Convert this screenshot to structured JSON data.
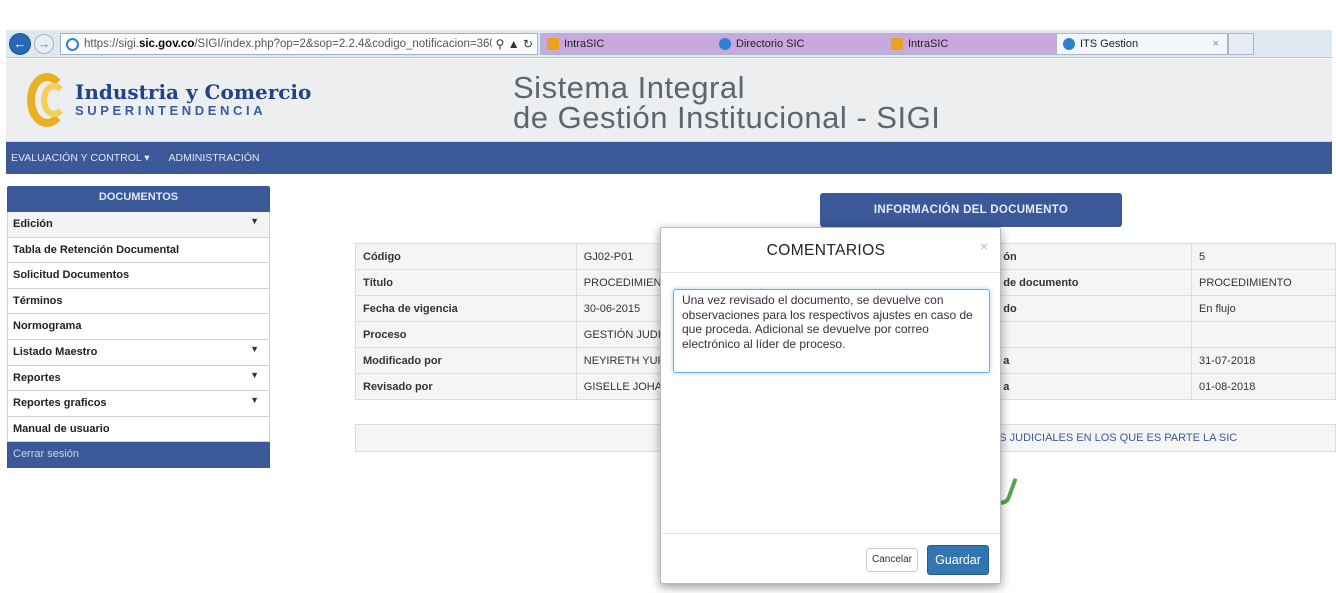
{
  "browser": {
    "url_prefix": "https://sigi.",
    "url_domain": "sic.gov.co",
    "url_rest": "/SIGI/index.php?op=2&sop=2.2.4&codigo_notificacion=3606",
    "tabs": [
      {
        "label": "IntraSIC",
        "style": "purple"
      },
      {
        "label": "Directorio SIC",
        "style": "purple"
      },
      {
        "label": "IntraSIC",
        "style": "purple"
      },
      {
        "label": "ITS Gestion",
        "style": "active"
      }
    ],
    "close_glyph": "×"
  },
  "header": {
    "logo_name": "Industria y Comercio",
    "logo_sub": "SUPERINTENDENCIA",
    "title_line1": "Sistema Integral",
    "title_line2": "de Gestión Institucional - SIGI"
  },
  "nav": {
    "items": [
      "EVALUACIÓN Y CONTROL ▾",
      "ADMINISTRACIÓN"
    ]
  },
  "sidebar": {
    "heading": "DOCUMENTOS",
    "items": [
      {
        "label": "Edición",
        "has_caret": true
      },
      {
        "label": "Tabla de Retención Documental",
        "has_caret": false
      },
      {
        "label": "Solicitud Documentos",
        "has_caret": false
      },
      {
        "label": "Términos",
        "has_caret": false
      },
      {
        "label": "Normograma",
        "has_caret": false
      },
      {
        "label": "Listado Maestro",
        "has_caret": true
      },
      {
        "label": "Reportes",
        "has_caret": true
      },
      {
        "label": "Reportes graficos",
        "has_caret": true
      },
      {
        "label": "Manual de usuario",
        "has_caret": false
      }
    ],
    "logout": "Cerrar sesión"
  },
  "info": {
    "button": "INFORMACIÓN DEL DOCUMENTO",
    "rows": [
      {
        "l1": "Código",
        "v1": "GJ02-P01",
        "l2": "ón",
        "v2": "5"
      },
      {
        "l1": "Título",
        "v1": "PROCEDIMIENT",
        "l2": "de documento",
        "v2": "PROCEDIMIENTO"
      },
      {
        "l1": "Fecha de vigencia",
        "v1": "30-06-2015",
        "l2": "do",
        "v2": "En flujo"
      },
      {
        "l1": "Proceso",
        "v1": "GESTIÓN JUDIC",
        "l2": "",
        "v2": ""
      },
      {
        "l1": "Modificado por",
        "v1": "NEYIRETH YUR",
        "l2": "a",
        "v2": "31-07-2018"
      },
      {
        "l1": "Revisado por",
        "v1": "GISELLE JOHA",
        "l2": "a",
        "v2": "01-08-2018"
      }
    ],
    "process_text": "ESOS JUDICIALES EN LOS QUE ES PARTE LA SIC"
  },
  "modal": {
    "title": "COMENTARIOS",
    "close": "×",
    "comment": "Una vez revisado el documento, se devuelve con observaciones para los respectivos ajustes en caso de que proceda. Adicional se devuelve por correo electrónico al líder de proceso.",
    "cancel": "Cancelar",
    "save": "Guardar"
  },
  "colors": {
    "brand_blue": "#3b5998",
    "primary_button": "#3276b1",
    "logo_gold": "#e8b022"
  }
}
